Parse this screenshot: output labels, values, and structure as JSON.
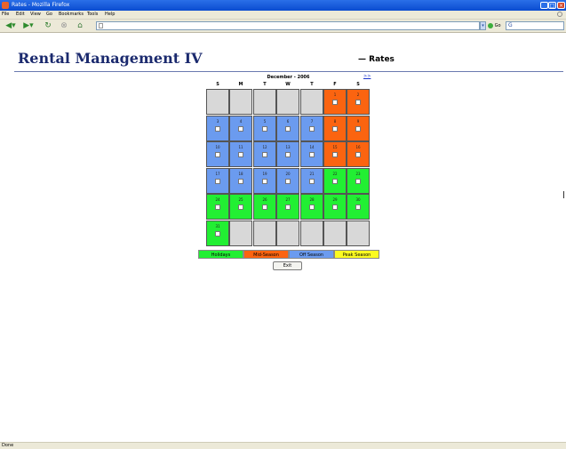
{
  "window": {
    "title": "Rates - Mozilla Firefox"
  },
  "menu": [
    "File",
    "Edit",
    "View",
    "Go",
    "Bookmarks",
    "Tools",
    "Help"
  ],
  "toolbar": {
    "url": "",
    "search": "G"
  },
  "page": {
    "app_title": "Rental Management IV",
    "title": "— Rates"
  },
  "calendar": {
    "month_label": "December - 2006",
    "next_label": ">>",
    "weekdays": [
      "S",
      "M",
      "T",
      "W",
      "T",
      "F",
      "S"
    ],
    "first_weekday": 5,
    "days_in_month": 31,
    "day_seasons": {
      "1": "mid",
      "2": "mid",
      "3": "off",
      "4": "off",
      "5": "off",
      "6": "off",
      "7": "off",
      "8": "mid",
      "9": "mid",
      "10": "off",
      "11": "off",
      "12": "off",
      "13": "off",
      "14": "off",
      "15": "mid",
      "16": "mid",
      "17": "off",
      "18": "off",
      "19": "off",
      "20": "off",
      "21": "off",
      "22": "holiday",
      "23": "holiday",
      "24": "holiday",
      "25": "holiday",
      "26": "holiday",
      "27": "holiday",
      "28": "holiday",
      "29": "holiday",
      "30": "holiday",
      "31": "holiday"
    }
  },
  "seasons": {
    "holiday": {
      "label": "Holidays",
      "color": "#22ef33"
    },
    "mid": {
      "label": "Mid-Season",
      "color": "#fb6410"
    },
    "off": {
      "label": "Off Season",
      "color": "#6b9bef"
    },
    "peak": {
      "label": "Peak Season",
      "color": "#fbfb21"
    },
    "empty": {
      "color": "#d8d8d8"
    }
  },
  "legend_order": [
    "holiday",
    "mid",
    "off",
    "peak"
  ],
  "buttons": {
    "exit": "Exit"
  },
  "status": {
    "text": "Done"
  }
}
